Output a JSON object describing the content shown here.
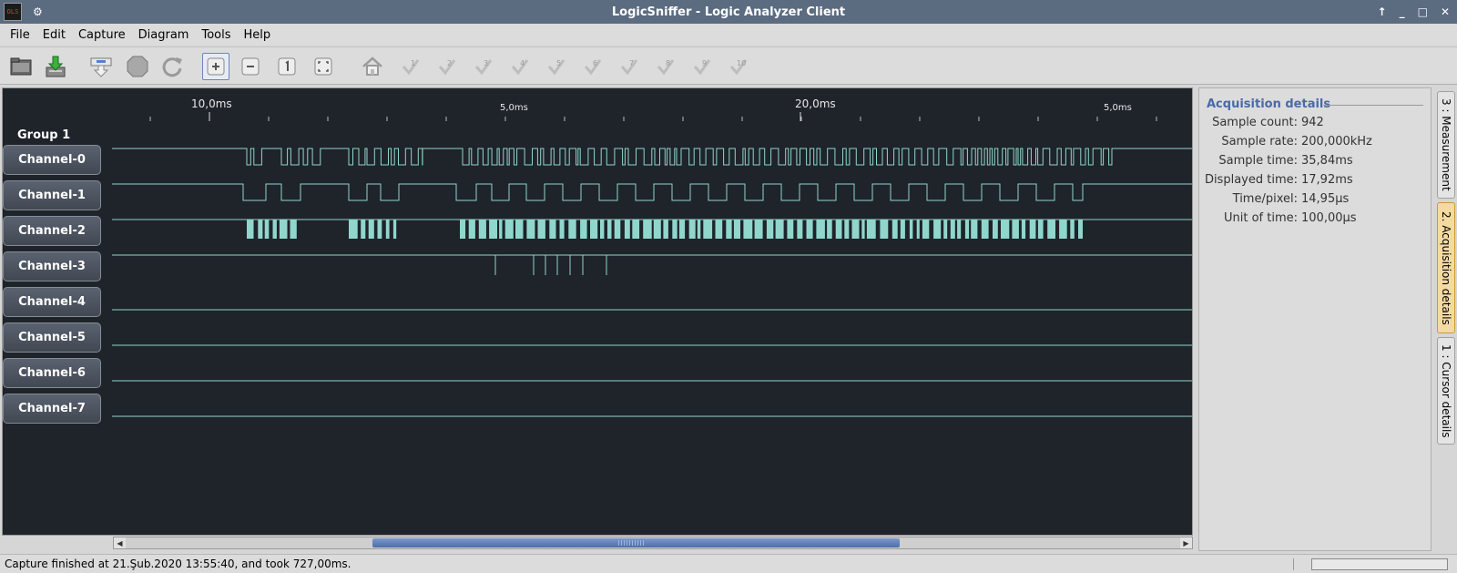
{
  "window": {
    "title": "LogicSniffer - Logic Analyzer Client",
    "app_icon_text": "OLS",
    "buttons": [
      "↑",
      "_",
      "□",
      "✕"
    ]
  },
  "menu": [
    {
      "label": "File"
    },
    {
      "label": "Edit"
    },
    {
      "label": "Capture"
    },
    {
      "label": "Diagram"
    },
    {
      "label": "Tools"
    },
    {
      "label": "Help"
    }
  ],
  "toolbar": {
    "icons": [
      "open-file-icon",
      "save-file-icon",
      "capture-icon",
      "stop-icon",
      "repeat-capture-icon",
      "zoom-in-icon",
      "zoom-out-icon",
      "zoom-original-icon",
      "zoom-fit-icon",
      "goto-trigger-icon",
      "goto-marker-1-icon",
      "goto-marker-2-icon",
      "goto-marker-3-icon",
      "goto-marker-4-icon",
      "goto-marker-5-icon",
      "goto-marker-6-icon",
      "goto-marker-7-icon",
      "goto-marker-8-icon",
      "goto-marker-9-icon",
      "goto-marker-10-icon"
    ],
    "marker_numbers": [
      "1",
      "2",
      "3",
      "4",
      "5",
      "6",
      "7",
      "8",
      "9",
      "10"
    ]
  },
  "timeline": {
    "major_labels": [
      "10,0ms",
      "20,0ms"
    ],
    "minor_labels": [
      "5,0ms",
      "5,0ms"
    ]
  },
  "group": {
    "label": "Group 1"
  },
  "channels": [
    "Channel-0",
    "Channel-1",
    "Channel-2",
    "Channel-3",
    "Channel-4",
    "Channel-5",
    "Channel-6",
    "Channel-7"
  ],
  "colors": {
    "signal": "#8fd6cc",
    "background": "#1f232a",
    "accent": "#4a6aa8"
  },
  "acquisition": {
    "title": "Acquisition details",
    "rows": [
      {
        "label": "Sample count:",
        "value": "942"
      },
      {
        "label": "Sample rate:",
        "value": "200,000kHz"
      },
      {
        "label": "Sample time:",
        "value": "35,84ms"
      },
      {
        "label": "Displayed time:",
        "value": "17,92ms"
      },
      {
        "label": "Time/pixel:",
        "value": "14,95µs"
      },
      {
        "label": "Unit of time:",
        "value": "100,00µs"
      }
    ]
  },
  "side_tabs": [
    "3 : Measurement",
    "2. Acquisition details",
    "1 : Cursor details"
  ],
  "status": {
    "message": "Capture finished at 21.Şub.2020 13:55:40, and took 727,00ms."
  }
}
